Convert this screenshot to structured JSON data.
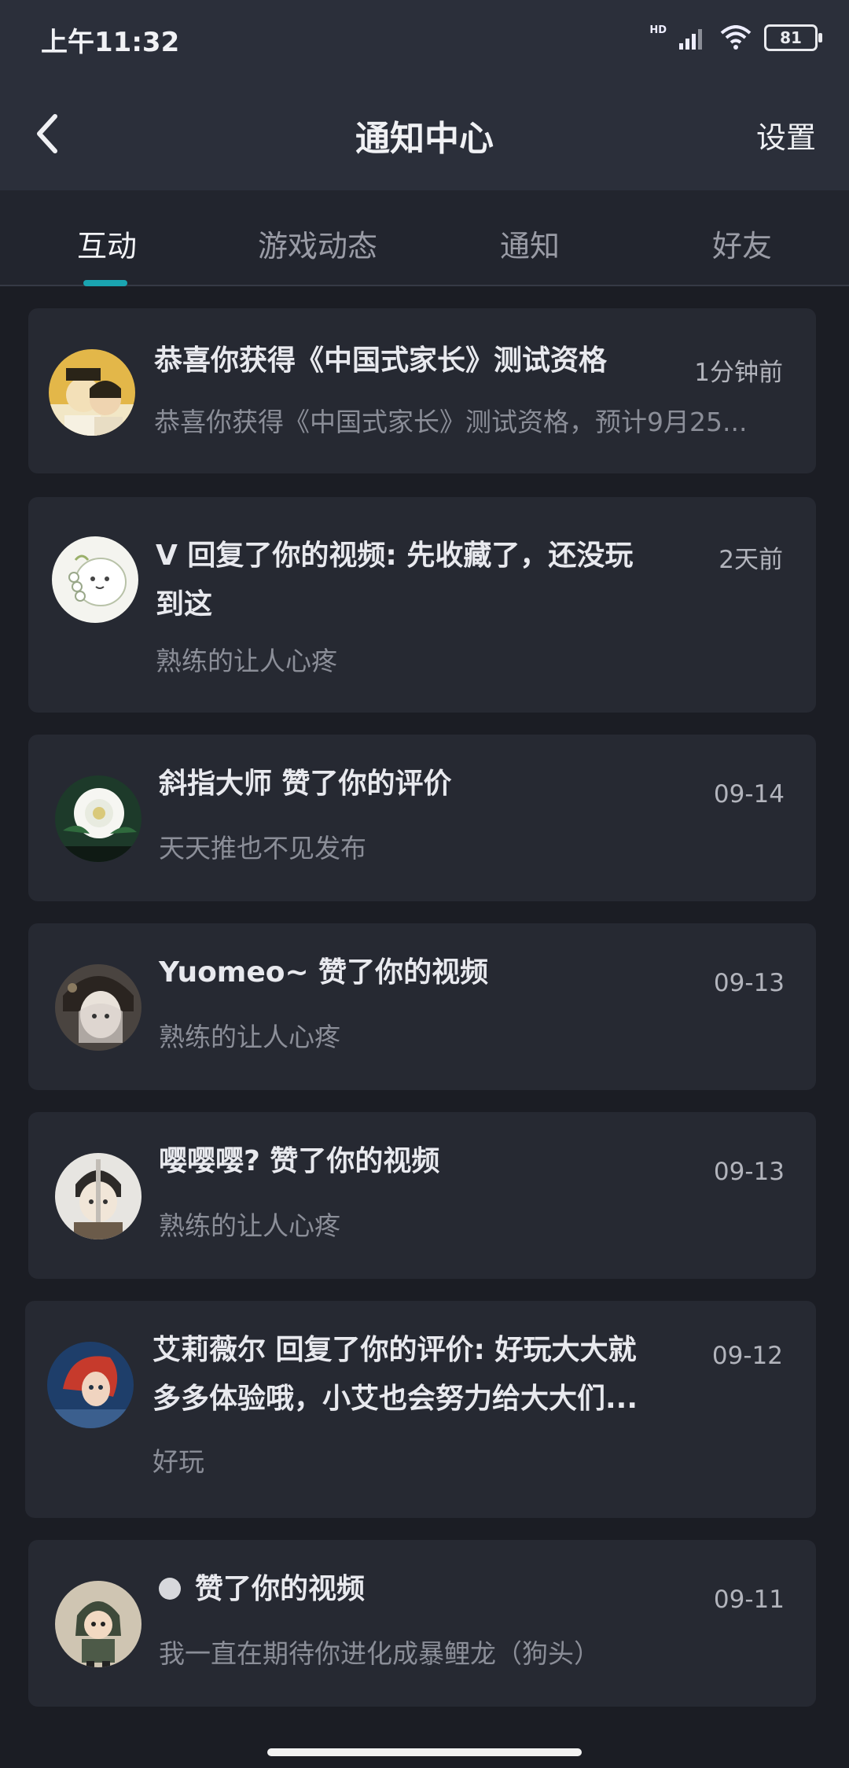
{
  "status_bar": {
    "time": "上午11:32",
    "network_badge": "HD",
    "battery": "81"
  },
  "header": {
    "title": "通知中心",
    "settings": "设置",
    "back_icon": "chevron-left-icon"
  },
  "tabs": [
    {
      "label": "互动",
      "active": true
    },
    {
      "label": "游戏动态",
      "active": false
    },
    {
      "label": "通知",
      "active": false
    },
    {
      "label": "好友",
      "active": false
    }
  ],
  "notifications": [
    {
      "title": "恭喜你获得《中国式家长》测试资格",
      "subtitle": "恭喜你获得《中国式家长》测试资格，预计9月25...",
      "time": "1分钟前"
    },
    {
      "title_line1": "V 回复了你的视频: 先收藏了，还没玩",
      "title_line2": "到这",
      "subtitle": "熟练的让人心疼",
      "time": "2天前"
    },
    {
      "title": "斜指大师 赞了你的评价",
      "subtitle": "天天推也不见发布",
      "time": "09-14"
    },
    {
      "title": "Yuomeo~ 赞了你的视频",
      "subtitle": "熟练的让人心疼",
      "time": "09-13"
    },
    {
      "title": "嘤嘤嘤? 赞了你的视频",
      "subtitle": "熟练的让人心疼",
      "time": "09-13"
    },
    {
      "title_line1": "艾莉薇尔 回复了你的评价: 好玩大大就",
      "title_line2": "多多体验哦，小艾也会努力给大大们...",
      "subtitle": "好玩",
      "time": "09-12"
    },
    {
      "title": "赞了你的视频",
      "subtitle": "我一直在期待你进化成暴鲤龙（狗头）",
      "time": "09-11"
    }
  ],
  "colors": {
    "background": "#1b1d24",
    "card": "#262932",
    "header": "#2b2f3a",
    "accent": "#1aa4b0"
  }
}
